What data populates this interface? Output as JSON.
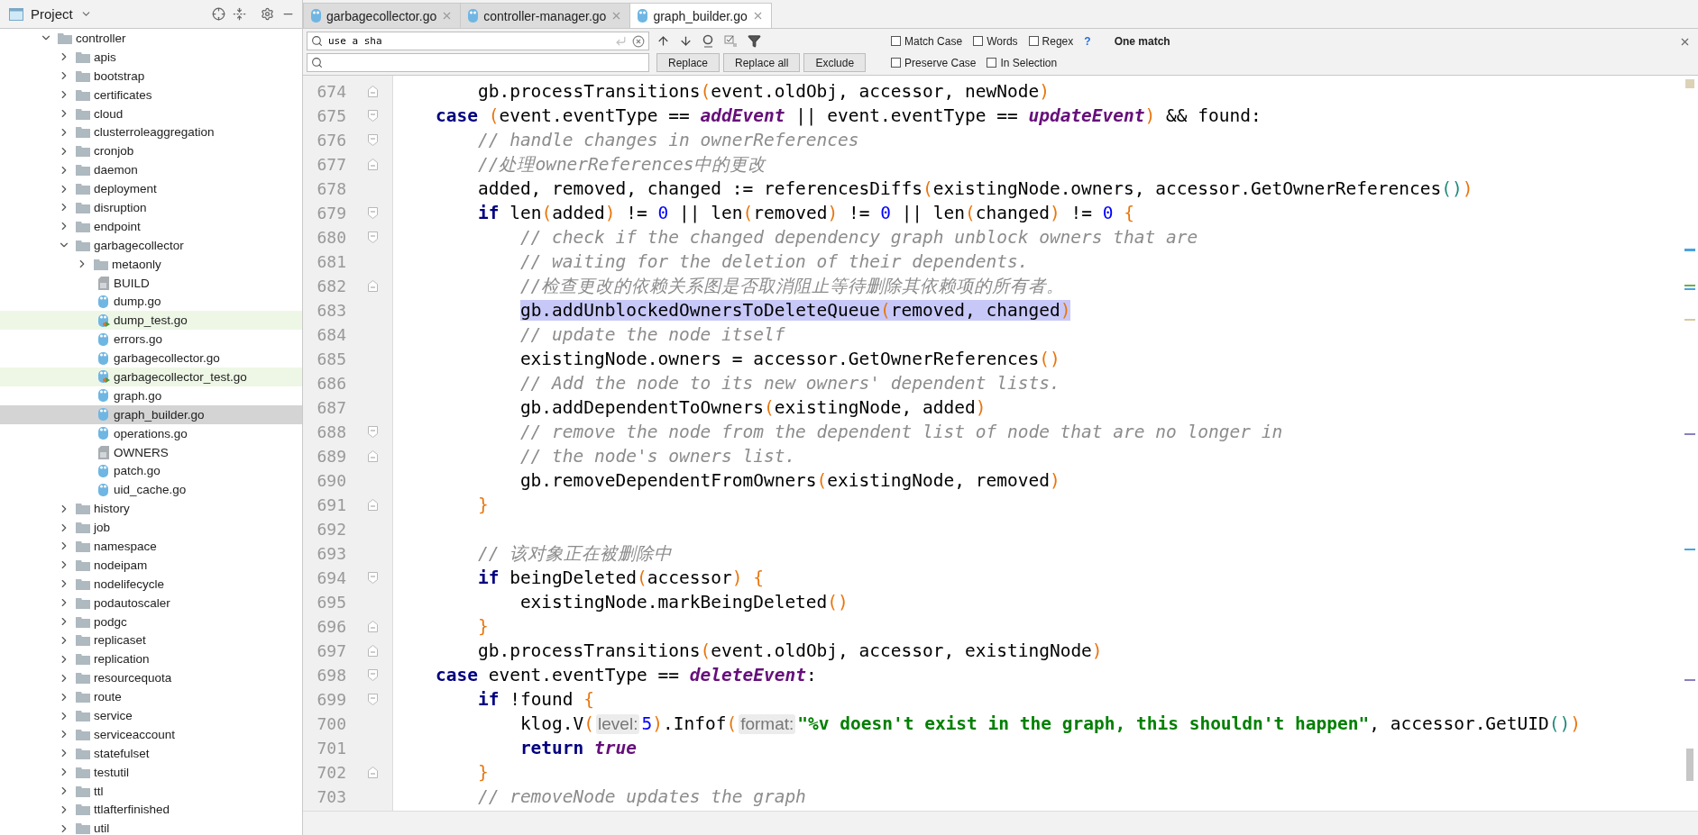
{
  "project_panel": {
    "title": "Project",
    "tree": [
      {
        "label": "controller",
        "kind": "folder",
        "expanded": true,
        "selected": false,
        "children": [
          {
            "label": "apis",
            "kind": "folder",
            "expanded": false,
            "selected": false
          },
          {
            "label": "bootstrap",
            "kind": "folder",
            "expanded": false,
            "selected": false
          },
          {
            "label": "certificates",
            "kind": "folder",
            "expanded": false,
            "selected": false
          },
          {
            "label": "cloud",
            "kind": "folder",
            "expanded": false,
            "selected": false
          },
          {
            "label": "clusterroleaggregation",
            "kind": "folder",
            "expanded": false,
            "selected": false
          },
          {
            "label": "cronjob",
            "kind": "folder",
            "expanded": false,
            "selected": false
          },
          {
            "label": "daemon",
            "kind": "folder",
            "expanded": false,
            "selected": false
          },
          {
            "label": "deployment",
            "kind": "folder",
            "expanded": false,
            "selected": false
          },
          {
            "label": "disruption",
            "kind": "folder",
            "expanded": false,
            "selected": false
          },
          {
            "label": "endpoint",
            "kind": "folder",
            "expanded": false,
            "selected": false
          },
          {
            "label": "garbagecollector",
            "kind": "folder",
            "expanded": true,
            "selected": false,
            "children": [
              {
                "label": "metaonly",
                "kind": "folder",
                "expanded": false,
                "selected": false
              },
              {
                "label": "BUILD",
                "kind": "text",
                "selected": false
              },
              {
                "label": "dump.go",
                "kind": "go",
                "selected": false
              },
              {
                "label": "dump_test.go",
                "kind": "test",
                "selected": false
              },
              {
                "label": "errors.go",
                "kind": "go",
                "selected": false
              },
              {
                "label": "garbagecollector.go",
                "kind": "go",
                "selected": false
              },
              {
                "label": "garbagecollector_test.go",
                "kind": "test",
                "selected": false
              },
              {
                "label": "graph.go",
                "kind": "go",
                "selected": false
              },
              {
                "label": "graph_builder.go",
                "kind": "go",
                "selected": true
              },
              {
                "label": "operations.go",
                "kind": "go",
                "selected": false
              },
              {
                "label": "OWNERS",
                "kind": "text",
                "selected": false
              },
              {
                "label": "patch.go",
                "kind": "go",
                "selected": false
              },
              {
                "label": "uid_cache.go",
                "kind": "go",
                "selected": false
              }
            ]
          },
          {
            "label": "history",
            "kind": "folder",
            "expanded": false,
            "selected": false
          },
          {
            "label": "job",
            "kind": "folder",
            "expanded": false,
            "selected": false
          },
          {
            "label": "namespace",
            "kind": "folder",
            "expanded": false,
            "selected": false
          },
          {
            "label": "nodeipam",
            "kind": "folder",
            "expanded": false,
            "selected": false
          },
          {
            "label": "nodelifecycle",
            "kind": "folder",
            "expanded": false,
            "selected": false
          },
          {
            "label": "podautoscaler",
            "kind": "folder",
            "expanded": false,
            "selected": false
          },
          {
            "label": "podgc",
            "kind": "folder",
            "expanded": false,
            "selected": false
          },
          {
            "label": "replicaset",
            "kind": "folder",
            "expanded": false,
            "selected": false
          },
          {
            "label": "replication",
            "kind": "folder",
            "expanded": false,
            "selected": false
          },
          {
            "label": "resourcequota",
            "kind": "folder",
            "expanded": false,
            "selected": false
          },
          {
            "label": "route",
            "kind": "folder",
            "expanded": false,
            "selected": false
          },
          {
            "label": "service",
            "kind": "folder",
            "expanded": false,
            "selected": false
          },
          {
            "label": "serviceaccount",
            "kind": "folder",
            "expanded": false,
            "selected": false
          },
          {
            "label": "statefulset",
            "kind": "folder",
            "expanded": false,
            "selected": false
          },
          {
            "label": "testutil",
            "kind": "folder",
            "expanded": false,
            "selected": false
          },
          {
            "label": "ttl",
            "kind": "folder",
            "expanded": false,
            "selected": false
          },
          {
            "label": "ttlafterfinished",
            "kind": "folder",
            "expanded": false,
            "selected": false
          },
          {
            "label": "util",
            "kind": "folder",
            "expanded": false,
            "selected": false
          }
        ]
      }
    ]
  },
  "tabs": [
    {
      "label": "garbagecollector.go",
      "selected": false
    },
    {
      "label": "controller-manager.go",
      "selected": false
    },
    {
      "label": "graph_builder.go",
      "selected": true
    }
  ],
  "search": {
    "find_value": "use a sha",
    "buttons": [
      "Replace",
      "Replace all",
      "Exclude"
    ],
    "options": [
      {
        "label": "Match Case",
        "checked": false
      },
      {
        "label": "Words",
        "checked": false
      },
      {
        "label": "Regex",
        "checked": false
      },
      {
        "label": "Preserve Case",
        "checked": false
      },
      {
        "label": "In Selection",
        "checked": false
      }
    ],
    "help": "?",
    "result": "One match"
  },
  "editor": {
    "lines": [
      {
        "number": "674",
        "fold_marker": {
          "kind": "end"
        },
        "match": false,
        "tokens": [
          {
            "kind": "plain",
            "text": "        gb.processTransitions"
          },
          {
            "kind": "paren",
            "text": "("
          },
          {
            "kind": "plain",
            "text": "event.oldObj, accessor, newNode"
          },
          {
            "kind": "paren",
            "text": ")"
          }
        ]
      },
      {
        "number": "675",
        "fold_marker": {
          "kind": "start"
        },
        "match": false,
        "tokens": [
          {
            "kind": "kw",
            "text": "    case"
          },
          {
            "kind": "paren",
            "text": " ("
          },
          {
            "kind": "plain",
            "text": "event.eventType == "
          },
          {
            "kind": "const",
            "text": "addEvent"
          },
          {
            "kind": "plain",
            "text": " || event.eventType == "
          },
          {
            "kind": "const",
            "text": "updateEvent"
          },
          {
            "kind": "paren",
            "text": ")"
          },
          {
            "kind": "plain",
            "text": " && found:"
          }
        ]
      },
      {
        "number": "676",
        "fold_marker": {
          "kind": "start"
        },
        "match": false,
        "tokens": [
          {
            "kind": "comment",
            "text": "        // handle changes in ownerReferences"
          }
        ]
      },
      {
        "number": "677",
        "fold_marker": {
          "kind": "end"
        },
        "match": false,
        "tokens": [
          {
            "kind": "comment",
            "text": "        //处理ownerReferences中的更改"
          }
        ]
      },
      {
        "number": "678",
        "match": false,
        "tokens": [
          {
            "kind": "plain",
            "text": "        added, removed, changed := referencesDiffs"
          },
          {
            "kind": "paren",
            "text": "("
          },
          {
            "kind": "plain",
            "text": "existingNode.owners, accessor.GetOwnerReferences"
          },
          {
            "kind": "paren2",
            "text": "()"
          },
          {
            "kind": "paren",
            "text": ")"
          }
        ]
      },
      {
        "number": "679",
        "fold_marker": {
          "kind": "start"
        },
        "match": false,
        "tokens": [
          {
            "kind": "kw",
            "text": "        if"
          },
          {
            "kind": "plain",
            "text": " len"
          },
          {
            "kind": "paren",
            "text": "("
          },
          {
            "kind": "plain",
            "text": "added"
          },
          {
            "kind": "paren",
            "text": ")"
          },
          {
            "kind": "plain",
            "text": " != "
          },
          {
            "kind": "num",
            "text": "0"
          },
          {
            "kind": "plain",
            "text": " || len"
          },
          {
            "kind": "paren",
            "text": "("
          },
          {
            "kind": "plain",
            "text": "removed"
          },
          {
            "kind": "paren",
            "text": ")"
          },
          {
            "kind": "plain",
            "text": " != "
          },
          {
            "kind": "num",
            "text": "0"
          },
          {
            "kind": "plain",
            "text": " || len"
          },
          {
            "kind": "paren",
            "text": "("
          },
          {
            "kind": "plain",
            "text": "changed"
          },
          {
            "kind": "paren",
            "text": ")"
          },
          {
            "kind": "plain",
            "text": " != "
          },
          {
            "kind": "num",
            "text": "0"
          },
          {
            "kind": "paren",
            "text": " {"
          }
        ]
      },
      {
        "number": "680",
        "fold_marker": {
          "kind": "start"
        },
        "match": false,
        "tokens": [
          {
            "kind": "comment",
            "text": "            // check if the changed dependency graph unblock owners that are"
          }
        ]
      },
      {
        "number": "681",
        "match": false,
        "tokens": [
          {
            "kind": "comment",
            "text": "            // waiting for the deletion of their dependents."
          }
        ]
      },
      {
        "number": "682",
        "fold_marker": {
          "kind": "end"
        },
        "match": false,
        "tokens": [
          {
            "kind": "comment",
            "text": "            //检查更改的依赖关系图是否取消阻止等待删除其依赖项的所有者。"
          }
        ]
      },
      {
        "number": "683",
        "match": true,
        "tokens": [
          {
            "kind": "plain",
            "text": "            gb.addUnblockedOwnersToDeleteQueue"
          },
          {
            "kind": "paren",
            "text": "("
          },
          {
            "kind": "plain",
            "text": "removed, changed"
          },
          {
            "kind": "paren",
            "text": ")"
          }
        ]
      },
      {
        "number": "684",
        "match": false,
        "tokens": [
          {
            "kind": "comment",
            "text": "            // update the node itself"
          }
        ]
      },
      {
        "number": "685",
        "match": false,
        "tokens": [
          {
            "kind": "plain",
            "text": "            existingNode.owners = accessor.GetOwnerReferences"
          },
          {
            "kind": "paren",
            "text": "()"
          }
        ]
      },
      {
        "number": "686",
        "match": false,
        "tokens": [
          {
            "kind": "comment",
            "text": "            // Add the node to its new owners' dependent lists."
          }
        ]
      },
      {
        "number": "687",
        "match": false,
        "tokens": [
          {
            "kind": "plain",
            "text": "            gb.addDependentToOwners"
          },
          {
            "kind": "paren",
            "text": "("
          },
          {
            "kind": "plain",
            "text": "existingNode, added"
          },
          {
            "kind": "paren",
            "text": ")"
          }
        ]
      },
      {
        "number": "688",
        "fold_marker": {
          "kind": "start"
        },
        "match": false,
        "tokens": [
          {
            "kind": "comment",
            "text": "            // remove the node from the dependent list of node that are no longer in"
          }
        ]
      },
      {
        "number": "689",
        "fold_marker": {
          "kind": "end"
        },
        "match": false,
        "tokens": [
          {
            "kind": "comment",
            "text": "            // the node's owners list."
          }
        ]
      },
      {
        "number": "690",
        "match": false,
        "tokens": [
          {
            "kind": "plain",
            "text": "            gb.removeDependentFromOwners"
          },
          {
            "kind": "paren",
            "text": "("
          },
          {
            "kind": "plain",
            "text": "existingNode, removed"
          },
          {
            "kind": "paren",
            "text": ")"
          }
        ]
      },
      {
        "number": "691",
        "fold_marker": {
          "kind": "end"
        },
        "match": false,
        "tokens": [
          {
            "kind": "paren",
            "text": "        }"
          }
        ]
      },
      {
        "number": "692"
      },
      {
        "number": "693",
        "match": false,
        "tokens": [
          {
            "kind": "comment",
            "text": "        // 该对象正在被删除中"
          }
        ]
      },
      {
        "number": "694",
        "fold_marker": {
          "kind": "start"
        },
        "match": false,
        "tokens": [
          {
            "kind": "kw",
            "text": "        if"
          },
          {
            "kind": "plain",
            "text": " beingDeleted"
          },
          {
            "kind": "paren",
            "text": "("
          },
          {
            "kind": "plain",
            "text": "accessor"
          },
          {
            "kind": "paren",
            "text": ") {"
          }
        ]
      },
      {
        "number": "695",
        "match": false,
        "tokens": [
          {
            "kind": "plain",
            "text": "            existingNode.markBeingDeleted"
          },
          {
            "kind": "paren",
            "text": "()"
          }
        ]
      },
      {
        "number": "696",
        "fold_marker": {
          "kind": "end"
        },
        "match": false,
        "tokens": [
          {
            "kind": "paren",
            "text": "        }"
          }
        ]
      },
      {
        "number": "697",
        "fold_marker": {
          "kind": "end"
        },
        "match": false,
        "tokens": [
          {
            "kind": "plain",
            "text": "        gb.processTransitions"
          },
          {
            "kind": "paren",
            "text": "("
          },
          {
            "kind": "plain",
            "text": "event.oldObj, accessor, existingNode"
          },
          {
            "kind": "paren",
            "text": ")"
          }
        ]
      },
      {
        "number": "698",
        "fold_marker": {
          "kind": "start"
        },
        "match": false,
        "tokens": [
          {
            "kind": "kw",
            "text": "    case"
          },
          {
            "kind": "plain",
            "text": " event.eventType == "
          },
          {
            "kind": "const",
            "text": "deleteEvent"
          },
          {
            "kind": "plain",
            "text": ":"
          }
        ]
      },
      {
        "number": "699",
        "fold_marker": {
          "kind": "start"
        },
        "match": false,
        "tokens": [
          {
            "kind": "kw",
            "text": "        if"
          },
          {
            "kind": "plain",
            "text": " !found"
          },
          {
            "kind": "paren",
            "text": " {"
          }
        ]
      },
      {
        "number": "700",
        "match": false,
        "tokens": [
          {
            "kind": "plain",
            "text": "            klog.V"
          },
          {
            "kind": "paren",
            "text": "("
          },
          {
            "kind": "hint",
            "text": "level:"
          },
          {
            "kind": "num",
            "text": "5"
          },
          {
            "kind": "paren",
            "text": ")"
          },
          {
            "kind": "plain",
            "text": ".Infof"
          },
          {
            "kind": "paren",
            "text": "("
          },
          {
            "kind": "hint",
            "text": "format:"
          },
          {
            "kind": "string",
            "text": "\"%v doesn't exist in the graph, this shouldn't happen\""
          },
          {
            "kind": "plain",
            "text": ", accessor.GetUID"
          },
          {
            "kind": "paren2",
            "text": "()"
          },
          {
            "kind": "paren",
            "text": ")"
          }
        ]
      },
      {
        "number": "701",
        "match": false,
        "tokens": [
          {
            "kind": "kw",
            "text": "            return"
          },
          {
            "kind": "const",
            "text": " true"
          }
        ]
      },
      {
        "number": "702",
        "fold_marker": {
          "kind": "end"
        },
        "match": false,
        "tokens": [
          {
            "kind": "paren",
            "text": "        }"
          }
        ]
      },
      {
        "number": "703",
        "match": false,
        "tokens": [
          {
            "kind": "comment",
            "text": "        // removeNode updates the graph"
          }
        ]
      }
    ]
  }
}
